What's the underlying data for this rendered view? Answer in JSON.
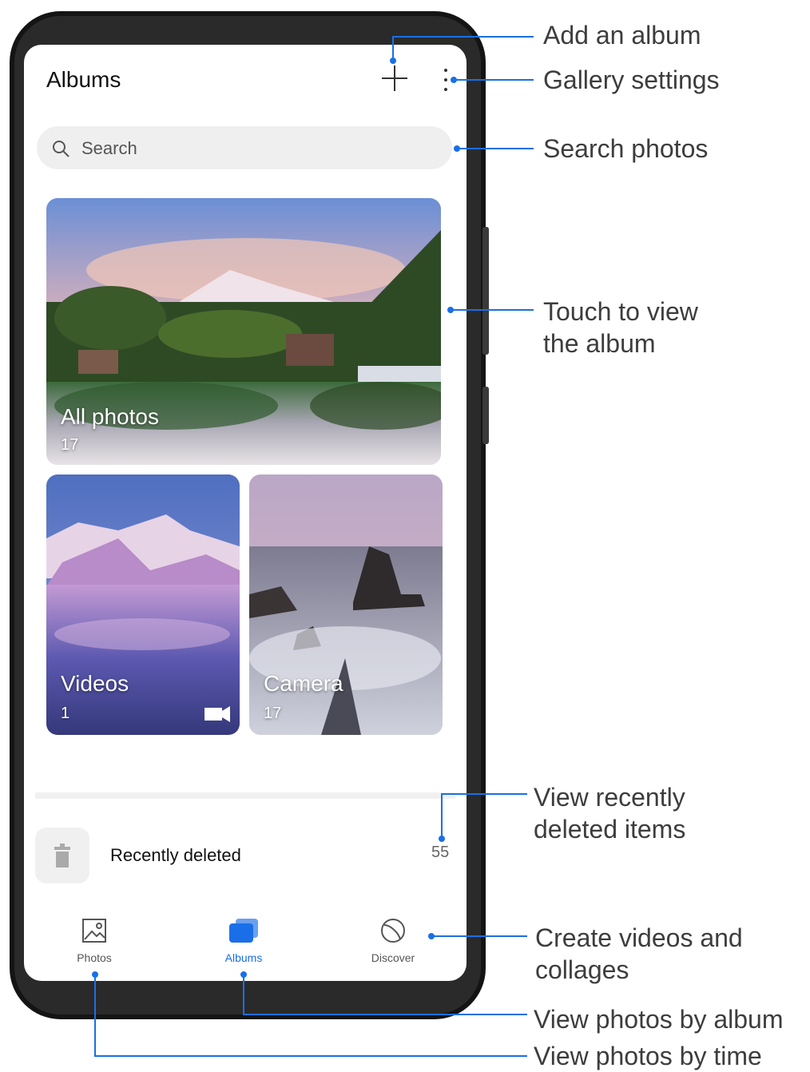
{
  "app": {
    "title": "Albums",
    "search_placeholder": "Search"
  },
  "albums": [
    {
      "name": "All photos",
      "count": "17"
    },
    {
      "name": "Videos",
      "count": "1"
    },
    {
      "name": "Camera",
      "count": "17"
    }
  ],
  "recently_deleted": {
    "label": "Recently deleted",
    "count": "55"
  },
  "bottom_nav": [
    {
      "label": "Photos",
      "icon": "image-icon",
      "active": false
    },
    {
      "label": "Albums",
      "icon": "albums-icon",
      "active": true
    },
    {
      "label": "Discover",
      "icon": "discover-icon",
      "active": false
    }
  ],
  "callouts": {
    "add_album": "Add an album",
    "gallery_settings": "Gallery settings",
    "search_photos": "Search photos",
    "touch_album_1": "Touch to view",
    "touch_album_2": "the album",
    "recently_deleted_1": "View recently",
    "recently_deleted_2": "deleted items",
    "create_1": "Create videos and",
    "create_2": "collages",
    "by_album": "View photos by album",
    "by_time": "View photos by time"
  },
  "colors": {
    "accent": "#1a6fe8",
    "callout_line": "#1a6fe8",
    "text_primary": "#111111"
  }
}
